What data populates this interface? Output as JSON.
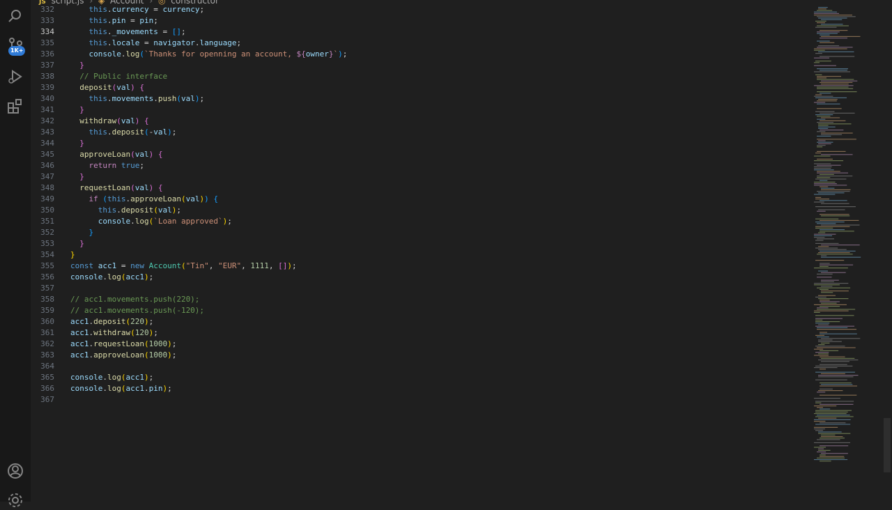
{
  "breadcrumb": {
    "file": "script.js",
    "class": "Account",
    "member": "constructor"
  },
  "activity_bar": {
    "badge": "1K+"
  },
  "editor": {
    "lines": [
      {
        "n": "332",
        "tokens": [
          [
            "    ",
            ""
          ],
          [
            "this",
            "t"
          ],
          [
            ".",
            ""
          ],
          [
            "currency",
            "v"
          ],
          [
            " = ",
            ""
          ],
          [
            "currency",
            "v"
          ],
          [
            ";",
            ""
          ]
        ]
      },
      {
        "n": "333",
        "tokens": [
          [
            "    ",
            ""
          ],
          [
            "this",
            "t"
          ],
          [
            ".",
            ""
          ],
          [
            "pin",
            "v"
          ],
          [
            " = ",
            ""
          ],
          [
            "pin",
            "v"
          ],
          [
            ";",
            ""
          ]
        ]
      },
      {
        "n": "334",
        "active": true,
        "tokens": [
          [
            "    ",
            ""
          ],
          [
            "this",
            "t"
          ],
          [
            ".",
            ""
          ],
          [
            "_movements",
            "v"
          ],
          [
            " = ",
            ""
          ],
          [
            "[]",
            "b3"
          ],
          [
            ";",
            ""
          ]
        ]
      },
      {
        "n": "335",
        "tokens": [
          [
            "    ",
            ""
          ],
          [
            "this",
            "t"
          ],
          [
            ".",
            ""
          ],
          [
            "locale",
            "v"
          ],
          [
            " = ",
            ""
          ],
          [
            "navigator",
            "v"
          ],
          [
            ".",
            ""
          ],
          [
            "language",
            "v"
          ],
          [
            ";",
            ""
          ]
        ]
      },
      {
        "n": "336",
        "tokens": [
          [
            "    ",
            ""
          ],
          [
            "console",
            "v"
          ],
          [
            ".",
            ""
          ],
          [
            "log",
            "f"
          ],
          [
            "(",
            "b3"
          ],
          [
            "`Thanks for openning an account, ",
            "s"
          ],
          [
            "${",
            "k"
          ],
          [
            "owner",
            "v"
          ],
          [
            "}",
            "k"
          ],
          [
            "`",
            "s"
          ],
          [
            ")",
            "b3"
          ],
          [
            ";",
            ""
          ]
        ]
      },
      {
        "n": "337",
        "tokens": [
          [
            "  ",
            ""
          ],
          [
            "}",
            "b2"
          ]
        ]
      },
      {
        "n": "338",
        "tokens": [
          [
            "  ",
            ""
          ],
          [
            "// Public interface",
            "c"
          ]
        ]
      },
      {
        "n": "339",
        "tokens": [
          [
            "  ",
            ""
          ],
          [
            "deposit",
            "f"
          ],
          [
            "(",
            "b2"
          ],
          [
            "val",
            "v"
          ],
          [
            ")",
            "b2"
          ],
          [
            " ",
            ""
          ],
          [
            "{",
            "b2"
          ]
        ]
      },
      {
        "n": "340",
        "tokens": [
          [
            "    ",
            ""
          ],
          [
            "this",
            "t"
          ],
          [
            ".",
            ""
          ],
          [
            "movements",
            "v"
          ],
          [
            ".",
            ""
          ],
          [
            "push",
            "f"
          ],
          [
            "(",
            "b3"
          ],
          [
            "val",
            "v"
          ],
          [
            ")",
            "b3"
          ],
          [
            ";",
            ""
          ]
        ]
      },
      {
        "n": "341",
        "tokens": [
          [
            "  ",
            ""
          ],
          [
            "}",
            "b2"
          ]
        ]
      },
      {
        "n": "342",
        "tokens": [
          [
            "  ",
            ""
          ],
          [
            "withdraw",
            "f"
          ],
          [
            "(",
            "b2"
          ],
          [
            "val",
            "v"
          ],
          [
            ")",
            "b2"
          ],
          [
            " ",
            ""
          ],
          [
            "{",
            "b2"
          ]
        ]
      },
      {
        "n": "343",
        "tokens": [
          [
            "    ",
            ""
          ],
          [
            "this",
            "t"
          ],
          [
            ".",
            ""
          ],
          [
            "deposit",
            "f"
          ],
          [
            "(",
            "b3"
          ],
          [
            "-",
            ""
          ],
          [
            "val",
            "v"
          ],
          [
            ")",
            "b3"
          ],
          [
            ";",
            ""
          ]
        ]
      },
      {
        "n": "344",
        "tokens": [
          [
            "  ",
            ""
          ],
          [
            "}",
            "b2"
          ]
        ]
      },
      {
        "n": "345",
        "tokens": [
          [
            "  ",
            ""
          ],
          [
            "approveLoan",
            "f"
          ],
          [
            "(",
            "b2"
          ],
          [
            "val",
            "v"
          ],
          [
            ")",
            "b2"
          ],
          [
            " ",
            ""
          ],
          [
            "{",
            "b2"
          ]
        ]
      },
      {
        "n": "346",
        "tokens": [
          [
            "    ",
            ""
          ],
          [
            "return",
            "k"
          ],
          [
            " ",
            ""
          ],
          [
            "true",
            "t"
          ],
          [
            ";",
            ""
          ]
        ]
      },
      {
        "n": "347",
        "tokens": [
          [
            "  ",
            ""
          ],
          [
            "}",
            "b2"
          ]
        ]
      },
      {
        "n": "348",
        "tokens": [
          [
            "  ",
            ""
          ],
          [
            "requestLoan",
            "f"
          ],
          [
            "(",
            "b2"
          ],
          [
            "val",
            "v"
          ],
          [
            ")",
            "b2"
          ],
          [
            " ",
            ""
          ],
          [
            "{",
            "b2"
          ]
        ]
      },
      {
        "n": "349",
        "tokens": [
          [
            "    ",
            ""
          ],
          [
            "if",
            "k"
          ],
          [
            " ",
            ""
          ],
          [
            "(",
            "b3"
          ],
          [
            "this",
            "t"
          ],
          [
            ".",
            ""
          ],
          [
            "approveLoan",
            "f"
          ],
          [
            "(",
            "b1"
          ],
          [
            "val",
            "v"
          ],
          [
            ")",
            "b1"
          ],
          [
            ")",
            "b3"
          ],
          [
            " ",
            ""
          ],
          [
            "{",
            "b3"
          ]
        ]
      },
      {
        "n": "350",
        "tokens": [
          [
            "      ",
            ""
          ],
          [
            "this",
            "t"
          ],
          [
            ".",
            ""
          ],
          [
            "deposit",
            "f"
          ],
          [
            "(",
            "b1"
          ],
          [
            "val",
            "v"
          ],
          [
            ")",
            "b1"
          ],
          [
            ";",
            ""
          ]
        ]
      },
      {
        "n": "351",
        "tokens": [
          [
            "      ",
            ""
          ],
          [
            "console",
            "v"
          ],
          [
            ".",
            ""
          ],
          [
            "log",
            "f"
          ],
          [
            "(",
            "b1"
          ],
          [
            "`Loan approved`",
            "s"
          ],
          [
            ")",
            "b1"
          ],
          [
            ";",
            ""
          ]
        ]
      },
      {
        "n": "352",
        "tokens": [
          [
            "    ",
            ""
          ],
          [
            "}",
            "b3"
          ]
        ]
      },
      {
        "n": "353",
        "tokens": [
          [
            "  ",
            ""
          ],
          [
            "}",
            "b2"
          ]
        ]
      },
      {
        "n": "354",
        "tokens": [
          [
            "}",
            "b1"
          ]
        ]
      },
      {
        "n": "355",
        "tokens": [
          [
            "const",
            "t"
          ],
          [
            " ",
            ""
          ],
          [
            "acc1",
            "v"
          ],
          [
            " = ",
            ""
          ],
          [
            "new",
            "t"
          ],
          [
            " ",
            ""
          ],
          [
            "Account",
            "cls"
          ],
          [
            "(",
            "b1"
          ],
          [
            "\"Tin\"",
            "s"
          ],
          [
            ", ",
            ""
          ],
          [
            "\"EUR\"",
            "s"
          ],
          [
            ", ",
            ""
          ],
          [
            "1111",
            "n"
          ],
          [
            ", ",
            ""
          ],
          [
            "[]",
            "b2"
          ],
          [
            ")",
            "b1"
          ],
          [
            ";",
            ""
          ]
        ]
      },
      {
        "n": "356",
        "tokens": [
          [
            "console",
            "v"
          ],
          [
            ".",
            ""
          ],
          [
            "log",
            "f"
          ],
          [
            "(",
            "b1"
          ],
          [
            "acc1",
            "v"
          ],
          [
            ")",
            "b1"
          ],
          [
            ";",
            ""
          ]
        ]
      },
      {
        "n": "357",
        "tokens": []
      },
      {
        "n": "358",
        "tokens": [
          [
            "// acc1.movements.push(220);",
            "c"
          ]
        ]
      },
      {
        "n": "359",
        "tokens": [
          [
            "// acc1.movements.push(-120);",
            "c"
          ]
        ]
      },
      {
        "n": "360",
        "tokens": [
          [
            "acc1",
            "v"
          ],
          [
            ".",
            ""
          ],
          [
            "deposit",
            "f"
          ],
          [
            "(",
            "b1"
          ],
          [
            "220",
            "n"
          ],
          [
            ")",
            "b1"
          ],
          [
            ";",
            ""
          ]
        ]
      },
      {
        "n": "361",
        "tokens": [
          [
            "acc1",
            "v"
          ],
          [
            ".",
            ""
          ],
          [
            "withdraw",
            "f"
          ],
          [
            "(",
            "b1"
          ],
          [
            "120",
            "n"
          ],
          [
            ")",
            "b1"
          ],
          [
            ";",
            ""
          ]
        ]
      },
      {
        "n": "362",
        "tokens": [
          [
            "acc1",
            "v"
          ],
          [
            ".",
            ""
          ],
          [
            "requestLoan",
            "f"
          ],
          [
            "(",
            "b1"
          ],
          [
            "1000",
            "n"
          ],
          [
            ")",
            "b1"
          ],
          [
            ";",
            ""
          ]
        ]
      },
      {
        "n": "363",
        "tokens": [
          [
            "acc1",
            "v"
          ],
          [
            ".",
            ""
          ],
          [
            "approveLoan",
            "f"
          ],
          [
            "(",
            "b1"
          ],
          [
            "1000",
            "n"
          ],
          [
            ")",
            "b1"
          ],
          [
            ";",
            ""
          ]
        ]
      },
      {
        "n": "364",
        "tokens": []
      },
      {
        "n": "365",
        "tokens": [
          [
            "console",
            "v"
          ],
          [
            ".",
            ""
          ],
          [
            "log",
            "f"
          ],
          [
            "(",
            "b1"
          ],
          [
            "acc1",
            "v"
          ],
          [
            ")",
            "b1"
          ],
          [
            ";",
            ""
          ]
        ]
      },
      {
        "n": "366",
        "tokens": [
          [
            "console",
            "v"
          ],
          [
            ".",
            ""
          ],
          [
            "log",
            "f"
          ],
          [
            "(",
            "b1"
          ],
          [
            "acc1",
            "v"
          ],
          [
            ".",
            ""
          ],
          [
            "pin",
            "v"
          ],
          [
            ")",
            "b1"
          ],
          [
            ";",
            ""
          ]
        ]
      },
      {
        "n": "367",
        "tokens": []
      }
    ]
  },
  "icons": {
    "activity": [
      "search-icon",
      "source-control-icon",
      "run-debug-icon",
      "extensions-icon",
      "account-icon",
      "settings-gear-icon"
    ]
  },
  "colors": {
    "editor_bg": "#1f1f1f",
    "activity_bg": "#181818",
    "badge": "#2f7bd8",
    "keyword": "#c586c0",
    "string": "#ce9178",
    "comment": "#6a9955"
  }
}
